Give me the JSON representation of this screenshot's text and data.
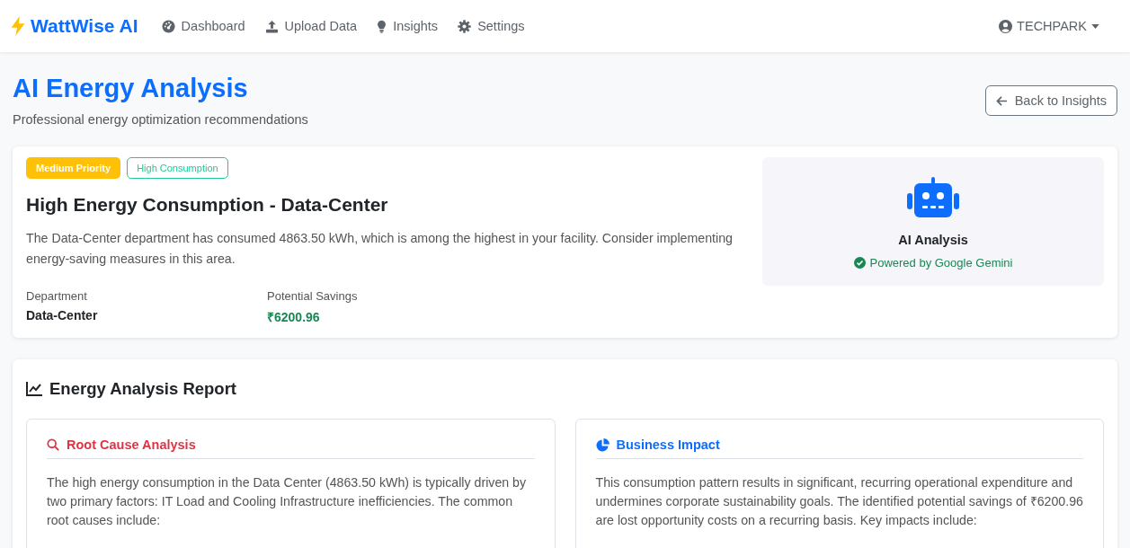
{
  "navbar": {
    "brand": "WattWise AI",
    "items": [
      {
        "label": "Dashboard",
        "selected": false
      },
      {
        "label": "Upload Data",
        "selected": false
      },
      {
        "label": "Insights",
        "selected": false
      },
      {
        "label": "Settings",
        "selected": false
      }
    ],
    "user": "TECHPARK"
  },
  "header": {
    "title": "AI Energy Analysis",
    "subtitle": "Professional energy optimization recommendations",
    "back_button": "Back to Insights"
  },
  "insight": {
    "tags": [
      {
        "label": "Medium Priority",
        "kind": "filled",
        "color": "#ffc107"
      },
      {
        "label": "High Consumption",
        "kind": "outline",
        "color": "#20c997"
      }
    ],
    "title": "High Energy Consumption - Data-Center",
    "description": "The Data-Center department has consumed 4863.50 kWh, which is among the highest in your facility. Consider implementing energy-saving measures in this area.",
    "fields": [
      {
        "label": "Department",
        "value": "Data-Center",
        "kind": "plain"
      },
      {
        "label": "Potential Savings",
        "value": "₹6200.96",
        "kind": "money"
      }
    ],
    "ai_panel": {
      "title": "AI Analysis",
      "status": "Powered by Google Gemini"
    }
  },
  "report": {
    "title": "Energy Analysis Report",
    "sections": [
      {
        "title": "Root Cause Analysis",
        "kind": "root_cause",
        "text": "The high energy consumption in the Data Center (4863.50 kWh) is typically driven by two primary factors: IT Load and Cooling Infrastructure inefficiencies. The common root causes include:"
      },
      {
        "title": "Business Impact",
        "kind": "impact",
        "text": "This consumption pattern results in significant, recurring operational expenditure and undermines corporate sustainability goals. The identified potential savings of ₹6200.96 are lost opportunity costs on a recurring basis. Key impacts include:"
      }
    ]
  }
}
